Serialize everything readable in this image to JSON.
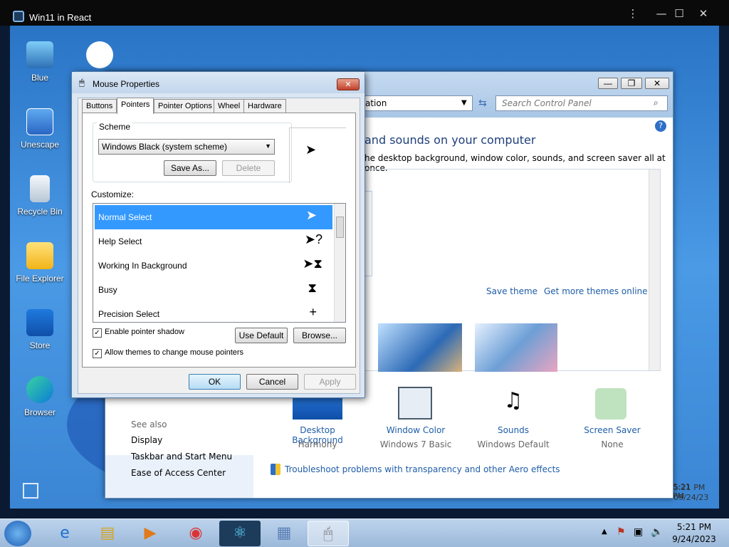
{
  "host": {
    "title": "Win11 in React",
    "controls": [
      "⋮",
      "—",
      "☐",
      "✕"
    ]
  },
  "desktop_icons": [
    {
      "label": "Blue"
    },
    {
      "label": ""
    },
    {
      "label": "Unescape"
    },
    {
      "label": "Recycle Bin"
    },
    {
      "label": "File Explorer"
    },
    {
      "label": "Store"
    },
    {
      "label": "Browser"
    }
  ],
  "control_panel": {
    "address": "ation",
    "search_placeholder": "Search Control Panel",
    "heading": "and sounds on your computer",
    "subheading": "he desktop background, window color, sounds, and screen saver all at once.",
    "save_theme": "Save theme",
    "get_more": "Get more themes online",
    "see_also": "See also",
    "see_also_links": [
      "Display",
      "Taskbar and Start Menu",
      "Ease of Access Center"
    ],
    "items": [
      {
        "label": "Desktop Background",
        "sub": "Harmony"
      },
      {
        "label": "Window Color",
        "sub": "Windows 7 Basic"
      },
      {
        "label": "Sounds",
        "sub": "Windows Default"
      },
      {
        "label": "Screen Saver",
        "sub": "None"
      }
    ],
    "troubleshoot": "Troubleshoot problems with transparency and other Aero effects",
    "clock_time": "5:21 PM",
    "clock_date": "09/24/23"
  },
  "mouse_props": {
    "title": "Mouse Properties",
    "tabs": [
      "Buttons",
      "Pointers",
      "Pointer Options",
      "Wheel",
      "Hardware"
    ],
    "scheme_label": "Scheme",
    "scheme_value": "Windows Black (system scheme)",
    "save_as": "Save As...",
    "delete": "Delete",
    "customize_label": "Customize:",
    "list": [
      {
        "label": "Normal Select",
        "cursor": "arrow"
      },
      {
        "label": "Help Select",
        "cursor": "help"
      },
      {
        "label": "Working In Background",
        "cursor": "working"
      },
      {
        "label": "Busy",
        "cursor": "hourglass"
      },
      {
        "label": "Precision Select",
        "cursor": "crosshair"
      }
    ],
    "enable_shadow": "Enable pointer shadow",
    "allow_themes": "Allow themes to change mouse pointers",
    "use_default": "Use Default",
    "browse": "Browse...",
    "ok": "OK",
    "cancel": "Cancel",
    "apply": "Apply"
  },
  "taskbar": {
    "time": "5:21 PM",
    "date": "9/24/2023"
  }
}
